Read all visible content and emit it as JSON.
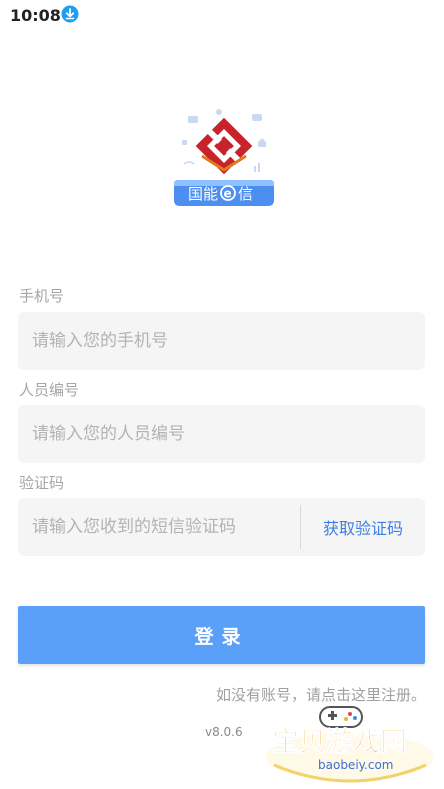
{
  "status_bar": {
    "time": "10:08",
    "download_icon": "download-icon"
  },
  "logo": {
    "badge_text": "国能",
    "badge_e": "e",
    "badge_text2": "信"
  },
  "form": {
    "phone": {
      "label": "手机号",
      "placeholder": "请输入您的手机号"
    },
    "staff_id": {
      "label": "人员编号",
      "placeholder": "请输入您的人员编号"
    },
    "code": {
      "label": "验证码",
      "placeholder": "请输入您收到的短信验证码",
      "button": "获取验证码"
    }
  },
  "login_button": "登录",
  "register_text": "如没有账号，请点击这里注册。",
  "version": "v8.0.6",
  "watermark": {
    "title": "宝贝游戏网",
    "url": "baobeiy.com"
  },
  "colors": {
    "primary": "#5aa0f8",
    "link": "#3d7ee6",
    "logo_red": "#c8232a"
  }
}
